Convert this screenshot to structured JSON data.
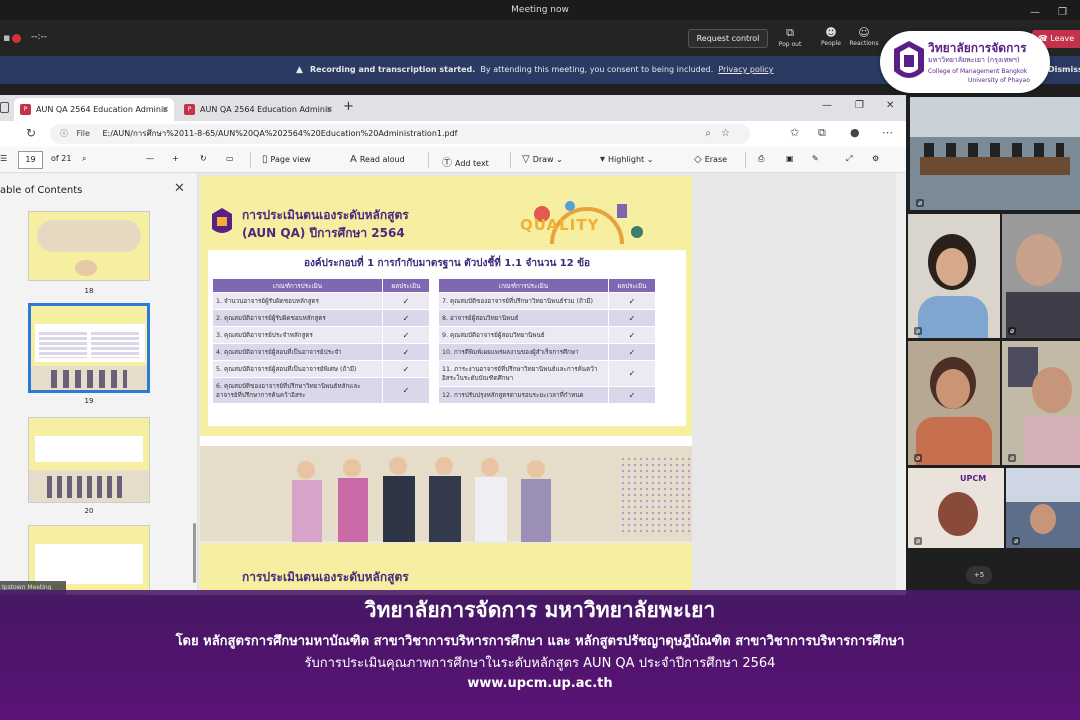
{
  "teams": {
    "window_title": "Meeting now",
    "timer": "--:--",
    "request_control_label": "Request control",
    "tools": [
      {
        "label": "Pop out",
        "icon": "pop-out-icon"
      },
      {
        "label": "People",
        "icon": "people-icon"
      },
      {
        "label": "Reactions",
        "icon": "reactions-icon"
      }
    ],
    "leave_label": "Leave"
  },
  "notice": {
    "bold": "Recording and transcription started.",
    "text": "By attending this meeting, you consent to being included.",
    "link": "Privacy policy",
    "dismiss": "Dismiss"
  },
  "logo": {
    "th_name": "วิทยาลัยการจัดการ",
    "th_sub": "มหาวิทยาลัยพะเยา (กรุงเทพฯ)",
    "en1": "College of Management Bangkok",
    "en2": "University of Phayao"
  },
  "browser": {
    "tabs": [
      {
        "label": "AUN QA 2564 Education Adminis"
      },
      {
        "label": "AUN QA 2564 Education Adminis"
      }
    ],
    "address_prefix": "File",
    "address": "E:/AUN/การศึกษา%2011-8-65/AUN%20QA%202564%20Education%20Administration1.pdf"
  },
  "pdfbar": {
    "page": "19",
    "of": "of 21",
    "page_view": "Page view",
    "read_aloud": "Read aloud",
    "add_text": "Add text",
    "draw": "Draw",
    "highlight": "Highlight",
    "erase": "Erase"
  },
  "toc": {
    "title": "able of Contents",
    "pages": [
      "18",
      "19",
      "20"
    ],
    "meeting_pill": "Ipstown Meeting"
  },
  "pdf": {
    "title1": "การประเมินตนเองระดับหลักสูตร",
    "title2": "(AUN QA) ปีการศึกษา 2564",
    "quality": "QUALITY",
    "heading": "องค์ประกอบที่ 1 การกำกับมาตรฐาน ตัวบ่งชี้ที่ 1.1 จำนวน 12 ข้อ",
    "col_criteria": "เกณฑ์การประเมิน",
    "col_result": "ผลประเมิน",
    "left_rows": [
      "1. จำนวนอาจารย์ผู้รับผิดชอบหลักสูตร",
      "2. คุณสมบัติอาจารย์ผู้รับผิดชอบหลักสูตร",
      "3. คุณสมบัติอาจารย์ประจำหลักสูตร",
      "4. คุณสมบัติอาจารย์ผู้สอนที่เป็นอาจารย์ประจำ",
      "5. คุณสมบัติอาจารย์ผู้สอนที่เป็นอาจารย์พิเศษ (ถ้ามี)",
      "6. คุณสมบัติของอาจารย์ที่ปรึกษาวิทยานิพนธ์หลักและ",
      "อาจารย์ที่ปรึกษาการค้นคว้าอิสระ"
    ],
    "right_rows": [
      "7. คุณสมบัติของอาจารย์ที่ปรึกษาวิทยานิพนธ์ร่วม (ถ้ามี)",
      "8. อาจารย์ผู้สอบวิทยานิพนธ์",
      "9. คุณสมบัติอาจารย์ผู้สอบวิทยานิพนธ์",
      "10. การตีพิมพ์เผยแพร่ผลงานของผู้สำเร็จการศึกษา",
      "11. ภาระงานอาจารย์ที่ปรึกษาวิทยานิพนธ์และการค้นคว้า",
      "อิสระในระดับบัณฑิตศึกษา",
      "12. การปรับปรุงหลักสูตรตามรอบระยะเวลาที่กำหนด"
    ],
    "check": "✓",
    "page3_title": "การประเมินตนเองระดับหลักสูตร"
  },
  "gallery": {
    "more": "+5",
    "upcm": "UPCM"
  },
  "caption": {
    "line1": "วิทยาลัยการจัดการ มหาวิทยาลัยพะเยา",
    "line2": "โดย หลักสูตรการศึกษามหาบัณฑิต สาขาวิชาการบริหารการศึกษา และ หลักสูตรปรัชญาดุษฎีบัณฑิต สาขาวิชาการบริหารการศึกษา",
    "line3": "รับการประเมินคุณภาพการศึกษาในระดับหลักสูตร AUN QA ประจำปีการศึกษา 2564",
    "line4": "www.upcm.up.ac.th"
  },
  "colors": {
    "brand_purple": "#5a1f86",
    "teams_notice": "#2b3a63",
    "leave_red": "#c4314b",
    "table_header": "#7e68b1",
    "pdf_yellow": "#f6eea1"
  }
}
